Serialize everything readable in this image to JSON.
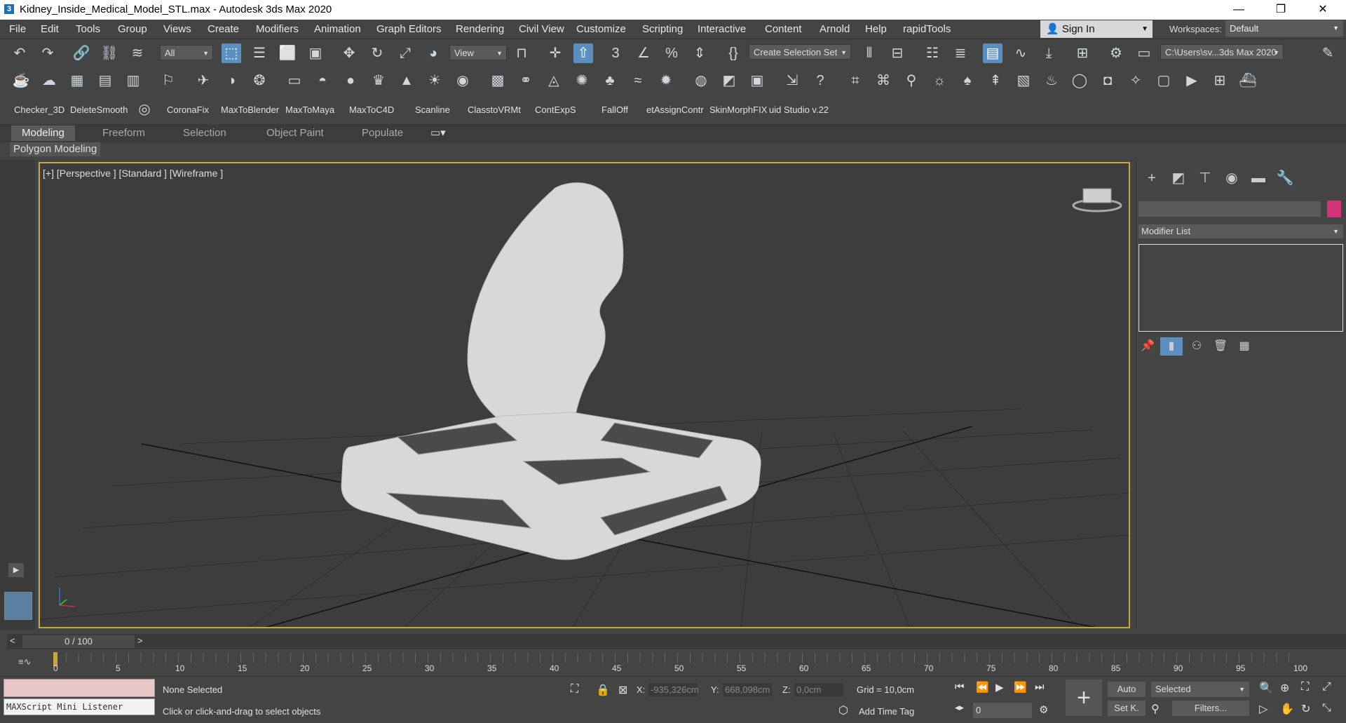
{
  "window": {
    "title": "Kidney_Inside_Medical_Model_STL.max - Autodesk 3ds Max 2020",
    "min": "—",
    "max": "❐",
    "close": "✕"
  },
  "menubar": {
    "items": [
      "File",
      "Edit",
      "Tools",
      "Group",
      "Views",
      "Create",
      "Modifiers",
      "Animation",
      "Graph Editors",
      "Rendering",
      "Civil View",
      "Customize",
      "Scripting",
      "Interactive",
      "Content",
      "Arnold",
      "Help",
      "rapidTools"
    ],
    "signin": "Sign In",
    "workspaces_label": "Workspaces:",
    "workspace": "Default"
  },
  "toolbar1": {
    "filter": "All",
    "refcoord": "View",
    "selection_set": "Create Selection Set",
    "project_path": "C:\\Users\\sv...3ds Max 2020"
  },
  "plugins": [
    "Checker_3D",
    "DeleteSmooth",
    "CoronaFix",
    "MaxToBlender",
    "MaxToMaya",
    "MaxToC4D",
    "Scanline",
    "ClasstoVRMt",
    "ContExpS",
    "FallOff",
    "etAssignContr",
    "SkinMorphFIX",
    "uid Studio v.22"
  ],
  "ribbon": {
    "tabs": [
      "Modeling",
      "Freeform",
      "Selection",
      "Object Paint",
      "Populate"
    ],
    "active": "Modeling",
    "panel_label": "Polygon Modeling"
  },
  "viewport": {
    "label": "[+] [Perspective ] [Standard ] [Wireframe ]",
    "border_color": "#c7a83c"
  },
  "command_panel": {
    "modifier_list": "Modifier List",
    "object_color": "#d2327a"
  },
  "timeslider": {
    "frame": "0 / 100",
    "prev": "<",
    "next": ">",
    "ticks": [
      "0",
      "5",
      "10",
      "15",
      "20",
      "25",
      "30",
      "35",
      "40",
      "45",
      "50",
      "55",
      "60",
      "65",
      "70",
      "75",
      "80",
      "85",
      "90",
      "95",
      "100"
    ]
  },
  "status": {
    "maxscript": "MAXScript Mini Listener",
    "selection": "None Selected",
    "prompt": "Click or click-and-drag to select objects",
    "x_label": "X:",
    "x": "-935,326cm",
    "y_label": "Y:",
    "y": "668,098cm",
    "z_label": "Z:",
    "z": "0,0cm",
    "grid": "Grid = 10,0cm",
    "add_time_tag": "Add Time Tag",
    "auto": "Auto",
    "setk": "Set K.",
    "selected_dd": "Selected",
    "filters": "Filters...",
    "frame_field": "0"
  }
}
